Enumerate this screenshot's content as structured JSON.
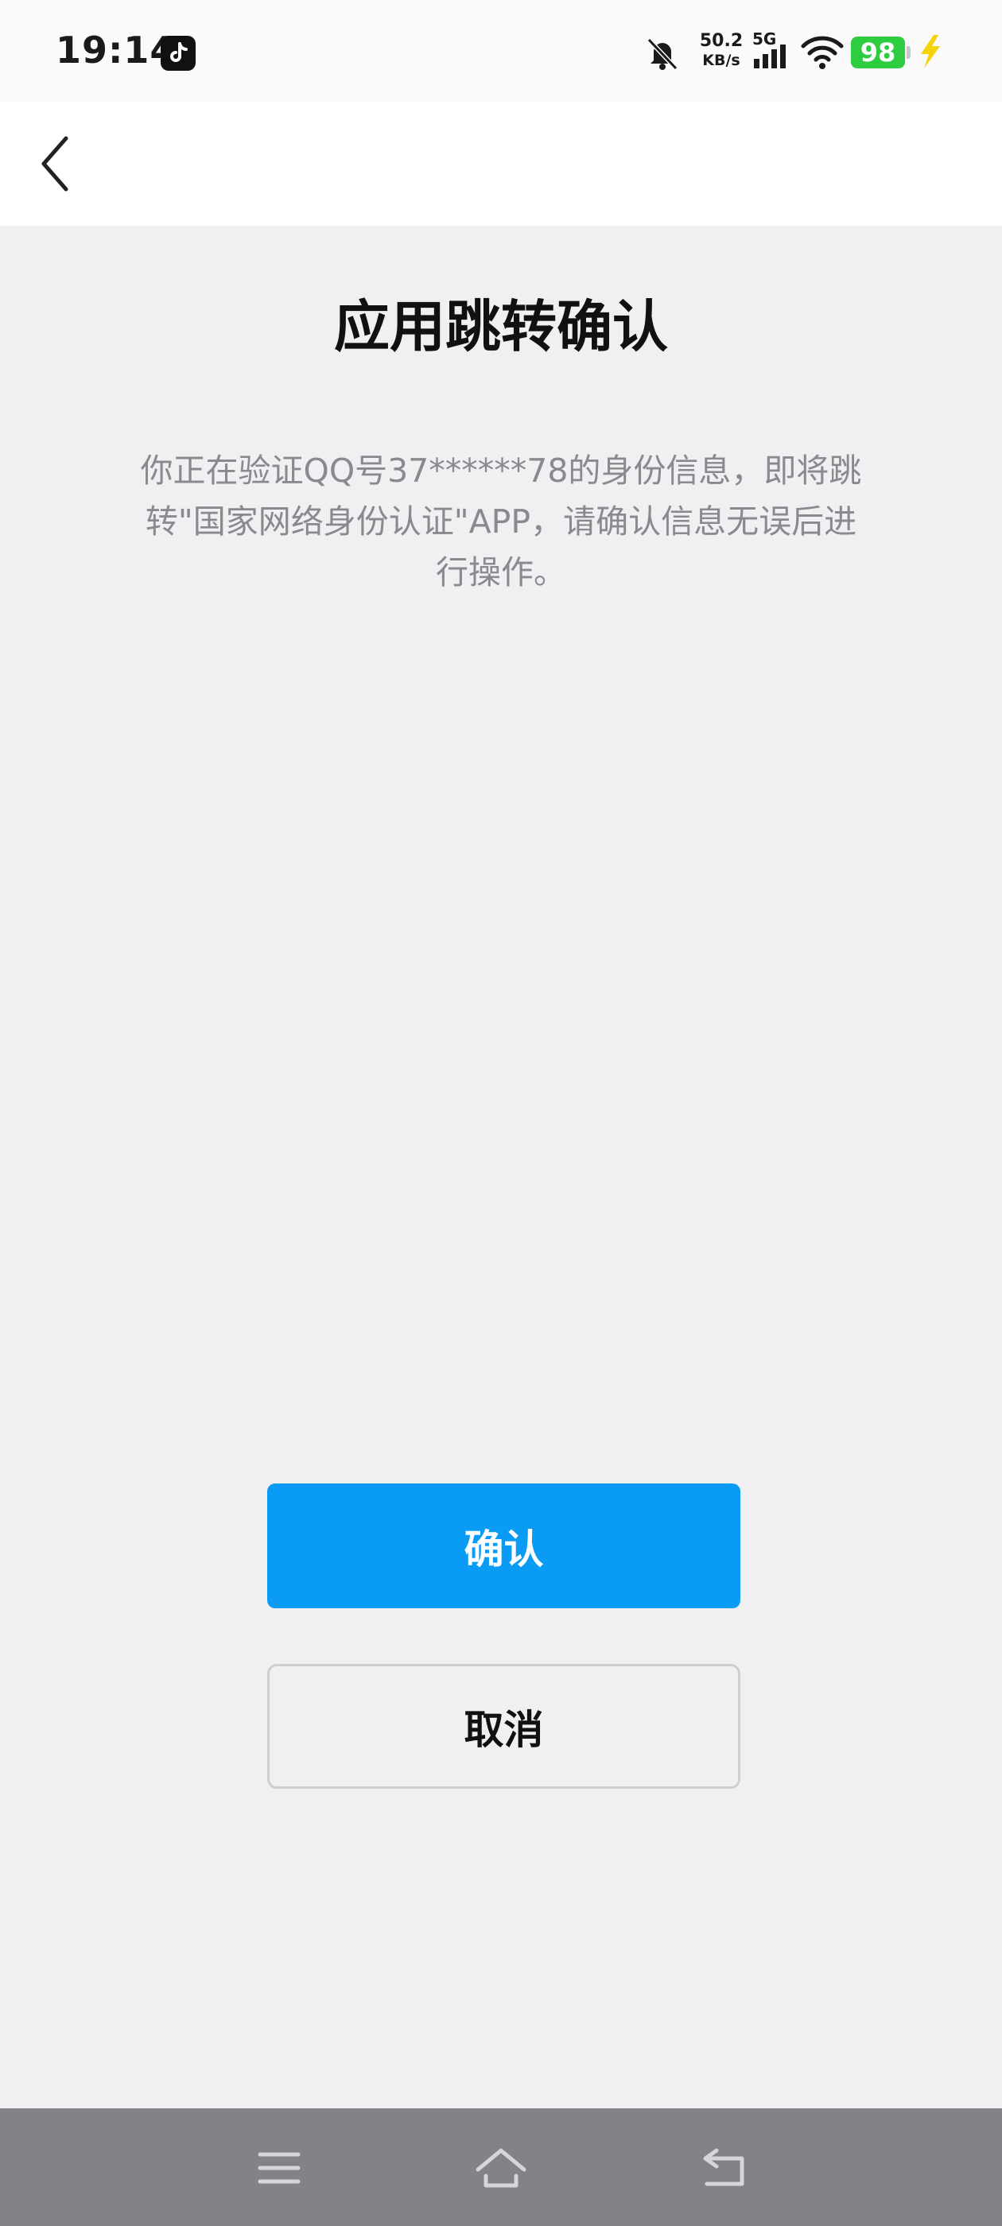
{
  "status_bar": {
    "time": "19:14",
    "net_speed_value": "50.2",
    "net_speed_unit": "KB/s",
    "network_type": "5G",
    "battery": "98"
  },
  "page": {
    "title": "应用跳转确认",
    "description": "你正在验证QQ号37******78的身份信息，即将跳转\"国家网络身份认证\"APP，请确认信息无误后进行操作。",
    "confirm_label": "确认",
    "cancel_label": "取消"
  },
  "icons": {
    "app": "tiktok-icon",
    "bell": "bell-off-icon",
    "back": "chevron-left-icon",
    "menu": "menu-icon",
    "home": "home-icon",
    "back_nav": "back-arrow-icon"
  },
  "colors": {
    "primary": "#0a9bf5",
    "battery": "#2ecc40",
    "background": "#f0f0f2"
  }
}
